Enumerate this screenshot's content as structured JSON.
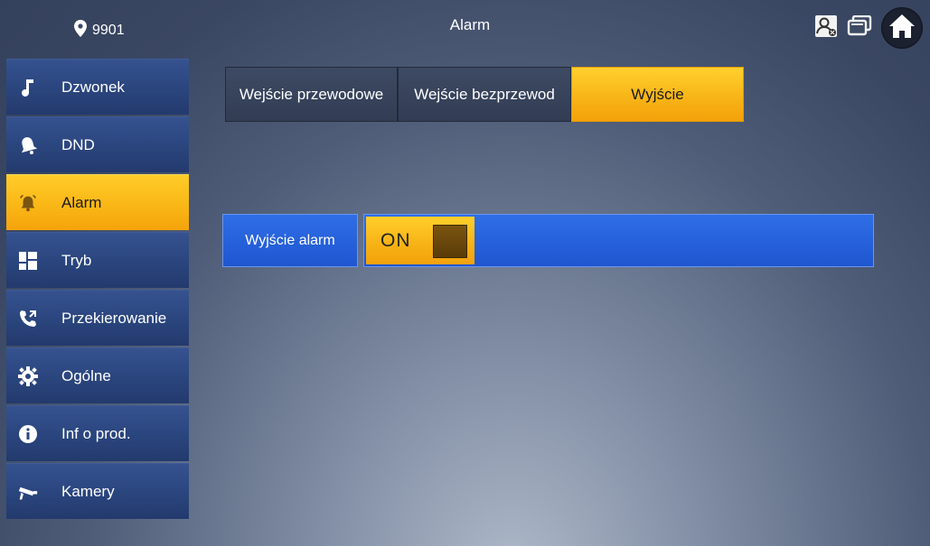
{
  "header": {
    "room_number": "9901",
    "title": "Alarm"
  },
  "top_icons": [
    "monitor-status-icon",
    "screens-icon",
    "home-icon"
  ],
  "sidebar": {
    "items": [
      {
        "label": "Dzwonek",
        "icon": "music-note-icon",
        "active": false
      },
      {
        "label": "DND",
        "icon": "bell-icon",
        "active": false
      },
      {
        "label": "Alarm",
        "icon": "alarm-bell-icon",
        "active": true
      },
      {
        "label": "Tryb",
        "icon": "grid-icon",
        "active": false
      },
      {
        "label": "Przekierowanie",
        "icon": "phone-forward-icon",
        "active": false
      },
      {
        "label": "Ogólne",
        "icon": "gear-icon",
        "active": false
      },
      {
        "label": "Inf o prod.",
        "icon": "info-icon",
        "active": false
      },
      {
        "label": "Kamery",
        "icon": "camera-icon",
        "active": false
      }
    ]
  },
  "tabs": [
    {
      "label": "Wejście przewodowe",
      "active": false
    },
    {
      "label": "Wejście bezprzewod",
      "active": false
    },
    {
      "label": "Wyjście",
      "active": true
    }
  ],
  "alarm_output": {
    "label": "Wyjście alarm",
    "toggle_value": "ON"
  },
  "colors": {
    "accent": "#f8b416",
    "sidebar_bg": "#2b467f",
    "control_blue": "#1f56d0",
    "background": "#4f5d78"
  }
}
